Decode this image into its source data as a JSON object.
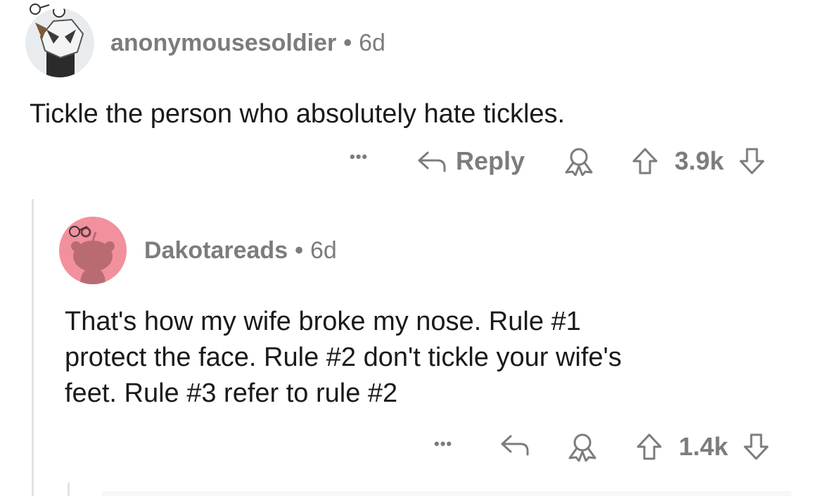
{
  "colors": {
    "meta_gray": "#7c7c7c",
    "thread_line": "#e3e3e3",
    "avatar_pink": "#f2919d"
  },
  "comments": [
    {
      "username": "anonymousesoldier",
      "separator": "•",
      "age": "6d",
      "text": "Tickle the person who absolutely hate tickles.",
      "actions": {
        "more": "•••",
        "reply": "Reply",
        "score": "3.9k"
      },
      "icons": [
        "snoo-avatar",
        "reply-arrow-icon",
        "award-icon",
        "upvote-icon",
        "downvote-icon"
      ]
    },
    {
      "username": "Dakotareads",
      "separator": "•",
      "age": "6d",
      "text_lines": [
        "That's how my wife broke my nose. Rule #1",
        "protect the face. Rule #2 don't tickle your wife's",
        "feet. Rule #3 refer to rule #2"
      ],
      "actions": {
        "more": "•••",
        "score": "1.4k"
      },
      "icons": [
        "snoo-avatar",
        "reply-arrow-icon",
        "award-icon",
        "upvote-icon",
        "downvote-icon"
      ]
    }
  ]
}
